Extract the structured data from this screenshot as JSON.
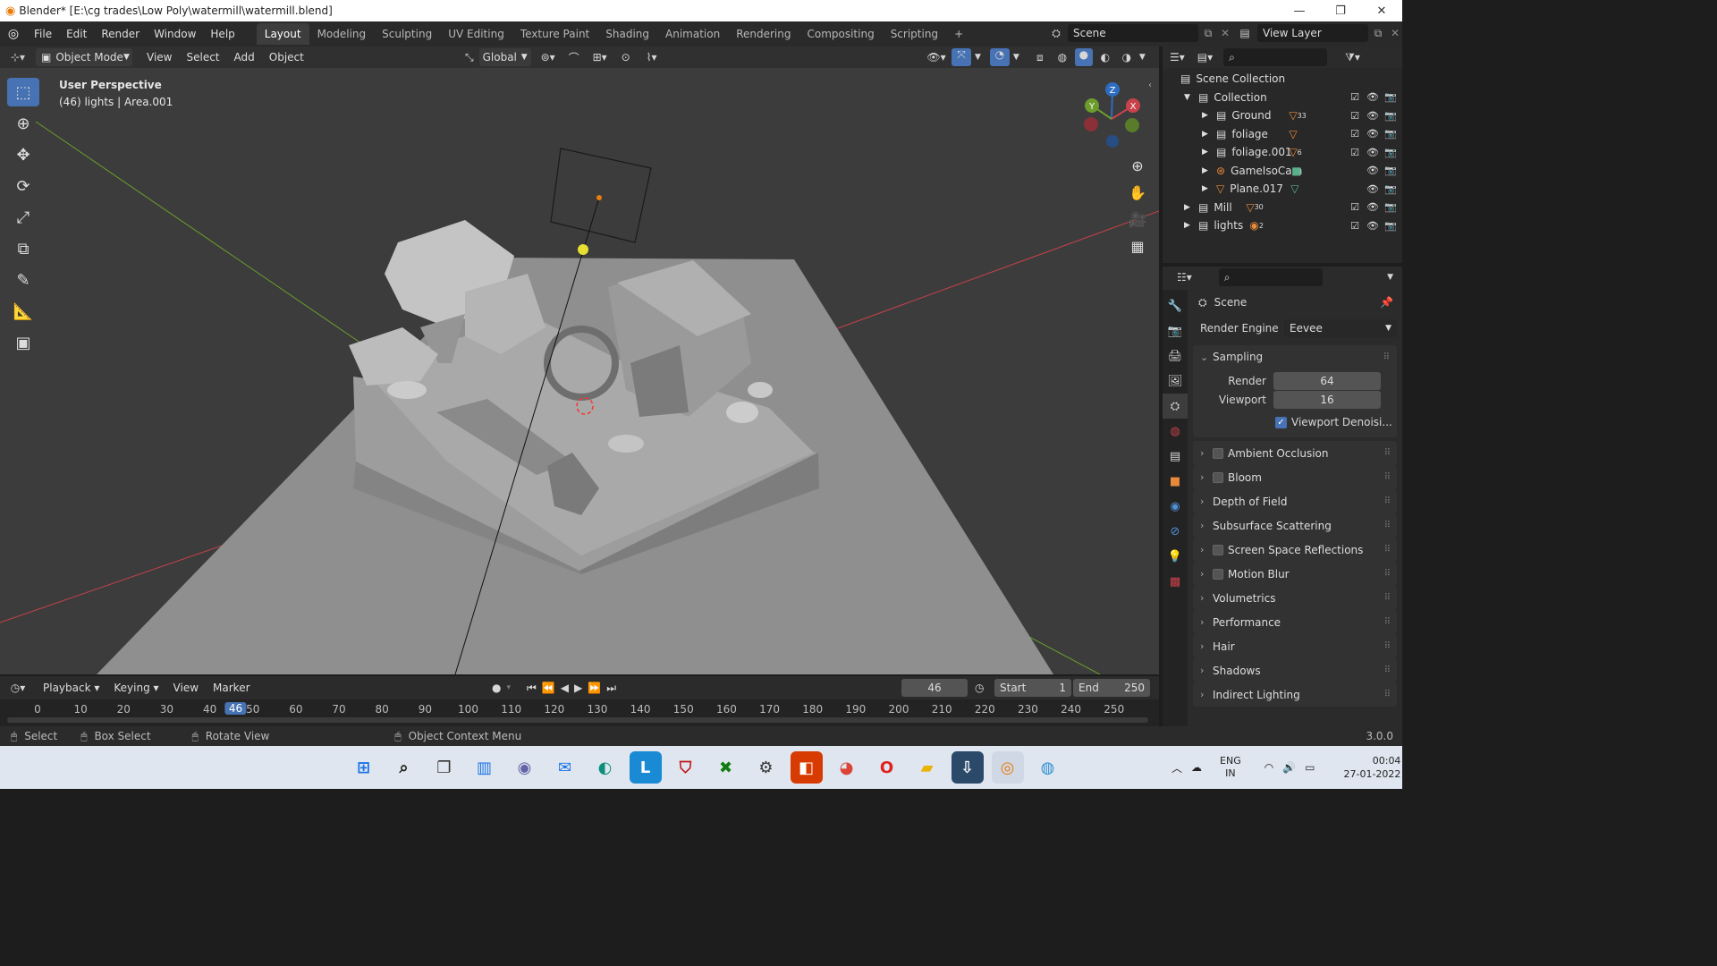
{
  "window": {
    "title": "Blender* [E:\\cg trades\\Low Poly\\watermill\\watermill.blend]",
    "min": "—",
    "restore": "❐",
    "close": "✕"
  },
  "menu": [
    "File",
    "Edit",
    "Render",
    "Window",
    "Help"
  ],
  "workspaces": [
    "Layout",
    "Modeling",
    "Sculpting",
    "UV Editing",
    "Texture Paint",
    "Shading",
    "Animation",
    "Rendering",
    "Compositing",
    "Scripting"
  ],
  "workspace_add": "+",
  "scene_name": "Scene",
  "view_layer": "View Layer",
  "viewport_header": {
    "mode": "Object Mode",
    "menus": [
      "View",
      "Select",
      "Add",
      "Object"
    ],
    "transform_orientation": "Global"
  },
  "viewport": {
    "overlay_line1": "User Perspective",
    "overlay_line2": "(46) lights | Area.001",
    "gizmo_x": "X",
    "gizmo_y": "Y",
    "gizmo_z": "Z"
  },
  "outliner": {
    "root": "Scene Collection",
    "items": [
      {
        "label": "Collection"
      },
      {
        "label": "Ground",
        "badge": "33"
      },
      {
        "label": "foliage"
      },
      {
        "label": "foliage.001",
        "badge": "6"
      },
      {
        "label": "GameIsoCam"
      },
      {
        "label": "Plane.017"
      },
      {
        "label": "Mill",
        "badge": "30"
      },
      {
        "label": "lights",
        "badge": "2"
      }
    ]
  },
  "properties": {
    "context": "Scene",
    "render_engine_label": "Render Engine",
    "render_engine_value": "Eevee",
    "sampling": {
      "title": "Sampling",
      "render_label": "Render",
      "render_value": "64",
      "viewport_label": "Viewport",
      "viewport_value": "16",
      "denoise_label": "Viewport Denoisi..."
    },
    "panels": [
      {
        "label": "Ambient Occlusion",
        "checkbox": true
      },
      {
        "label": "Bloom",
        "checkbox": true
      },
      {
        "label": "Depth of Field",
        "checkbox": false
      },
      {
        "label": "Subsurface Scattering",
        "checkbox": false
      },
      {
        "label": "Screen Space Reflections",
        "checkbox": true
      },
      {
        "label": "Motion Blur",
        "checkbox": true
      },
      {
        "label": "Volumetrics",
        "checkbox": false
      },
      {
        "label": "Performance",
        "checkbox": false
      },
      {
        "label": "Hair",
        "checkbox": false
      },
      {
        "label": "Shadows",
        "checkbox": false
      },
      {
        "label": "Indirect Lighting",
        "checkbox": false
      }
    ]
  },
  "timeline": {
    "menus": [
      "Playback",
      "Keying",
      "View",
      "Marker"
    ],
    "current_frame": "46",
    "start_label": "Start",
    "start_value": "1",
    "end_label": "End",
    "end_value": "250",
    "ticks": [
      "0",
      "10",
      "20",
      "30",
      "40",
      "50",
      "60",
      "70",
      "80",
      "90",
      "100",
      "110",
      "120",
      "130",
      "140",
      "150",
      "160",
      "170",
      "180",
      "190",
      "200",
      "210",
      "220",
      "230",
      "240",
      "250"
    ],
    "playhead": "46"
  },
  "statusbar": {
    "select": "Select",
    "box_select": "Box Select",
    "rotate": "Rotate View",
    "context_menu": "Object Context Menu",
    "version": "3.0.0"
  },
  "taskbar": {
    "lang1": "ENG",
    "lang2": "IN",
    "time": "00:04",
    "date": "27-01-2022",
    "apps": [
      "start-icon",
      "search-icon",
      "task-view-icon",
      "widgets-icon",
      "teams-icon",
      "mail-icon",
      "edge-icon",
      "l-app-icon",
      "mcafee-icon",
      "xbox-icon",
      "settings-icon",
      "office-icon",
      "chrome-icon",
      "opera-icon",
      "file-explorer-icon",
      "blender-launcher-icon",
      "blender-icon",
      "globe-icon"
    ]
  },
  "colors": {
    "accent_blue": "#4772b3",
    "x_axis": "#c8424a",
    "y_axis": "#6c9d2c",
    "z_axis": "#2d6cc0"
  }
}
